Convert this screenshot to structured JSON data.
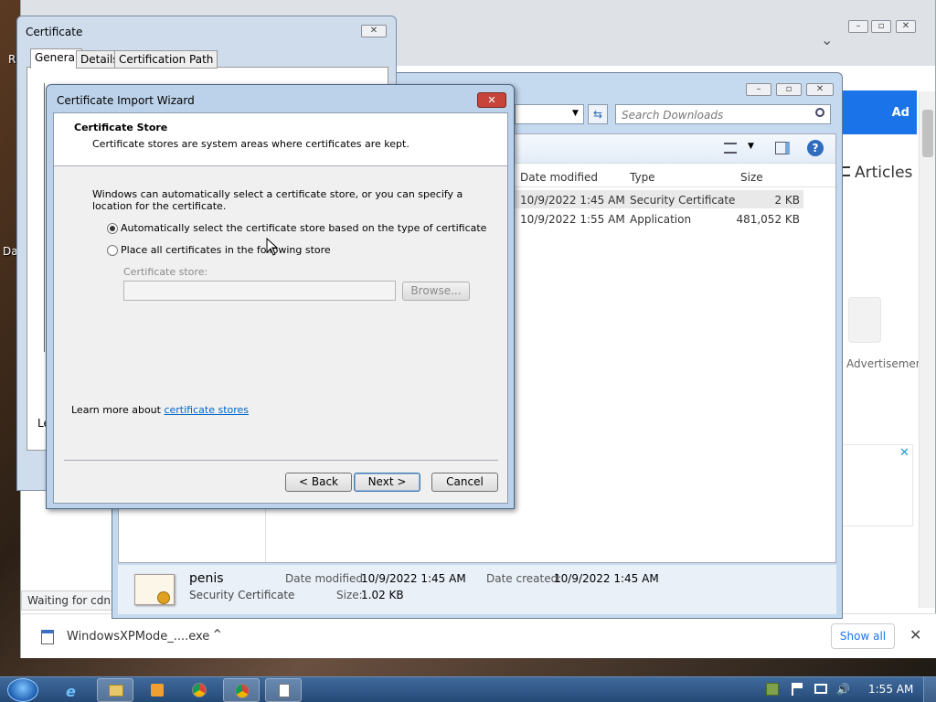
{
  "desktop": {
    "labels": [
      "R",
      "Da"
    ]
  },
  "chrome": {
    "tab_chevron": "⌄",
    "page": {
      "ad_label": "Ad",
      "articles": "Articles",
      "advertisement": "Advertisement",
      "ad_close": "✕"
    },
    "status_text": "Waiting for cdn.vi",
    "download": {
      "file_name": "WindowsXPMode_....exe",
      "show_all": "Show all"
    },
    "icons": {
      "close": "✕",
      "caret": "⌃"
    }
  },
  "explorer": {
    "search_placeholder": "Search Downloads",
    "columns": [
      "Date modified",
      "Type",
      "Size"
    ],
    "rows": [
      {
        "date": "10/9/2022 1:45 AM",
        "type": "Security Certificate",
        "size": "2 KB"
      },
      {
        "date": "10/9/2022 1:55 AM",
        "type": "Application",
        "size": "481,052 KB"
      }
    ],
    "details": {
      "name": "penis",
      "type": "Security Certificate",
      "modified_label": "Date modified:",
      "modified_value": "10/9/2022 1:45 AM",
      "created_label": "Date created:",
      "created_value": "10/9/2022 1:45 AM",
      "size_label": "Size:",
      "size_value": "1.02 KB"
    }
  },
  "certificate_window": {
    "title": "Certificate",
    "tabs": [
      "General",
      "Details",
      "Certification Path"
    ],
    "partial_text": "Le"
  },
  "wizard": {
    "title": "Certificate Import Wizard",
    "section_title": "Certificate Store",
    "section_desc": "Certificate stores are system areas where certificates are kept.",
    "intro": "Windows can automatically select a certificate store, or you can specify a location for the certificate.",
    "option_auto": "Automatically select the certificate store based on the type of certificate",
    "option_manual": "Place all certificates in the following store",
    "store_label": "Certificate store:",
    "browse": "Browse...",
    "learn_more": "Learn more about ",
    "learn_link": "certificate stores",
    "back": "< Back",
    "next": "Next >",
    "cancel": "Cancel"
  },
  "taskbar": {
    "time": "1:55 AM"
  }
}
